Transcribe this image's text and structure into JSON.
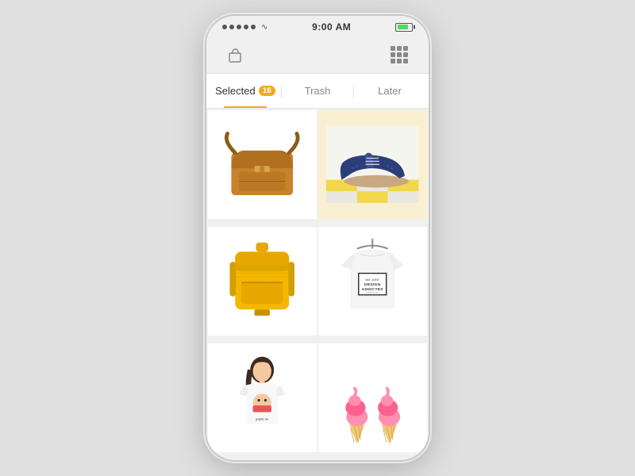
{
  "statusBar": {
    "time": "9:00 AM",
    "dotCount": 5,
    "wifiSymbol": "⌔",
    "batteryFill": 80
  },
  "tabs": [
    {
      "id": "selected",
      "label": "Selected",
      "badge": "16",
      "active": true
    },
    {
      "id": "trash",
      "label": "Trash",
      "badge": null,
      "active": false
    },
    {
      "id": "later",
      "label": "Later",
      "badge": null,
      "active": false
    }
  ],
  "products": [
    {
      "id": 1,
      "type": "bag",
      "description": "Brown leather messenger bag"
    },
    {
      "id": 2,
      "type": "shoe",
      "description": "Navy blue suede oxford shoe"
    },
    {
      "id": 3,
      "type": "backpack",
      "description": "Yellow woven backpack"
    },
    {
      "id": 4,
      "type": "tshirt",
      "description": "Design Addicted white t-shirt"
    },
    {
      "id": 5,
      "type": "woman-tshirt",
      "description": "Woman in white t-shirt with graphic"
    },
    {
      "id": 6,
      "type": "icecream",
      "description": "Two pink ice cream cones"
    }
  ],
  "colors": {
    "accent": "#f5a623",
    "tabActive": "#333",
    "tabInactive": "#888",
    "background": "#f0f0f0"
  }
}
